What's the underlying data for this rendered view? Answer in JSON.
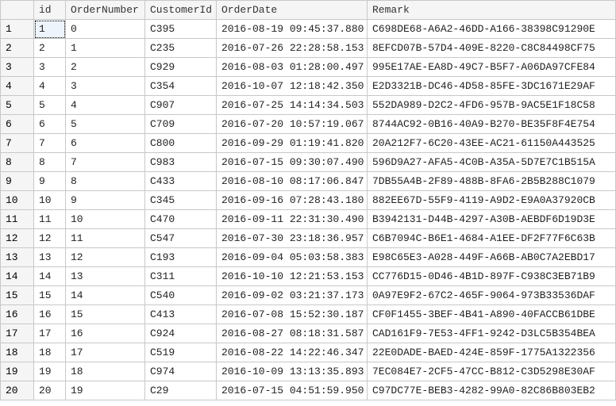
{
  "columns": {
    "id": "id",
    "orderNumber": "OrderNumber",
    "customerId": "CustomerId",
    "orderDate": "OrderDate",
    "remark": "Remark"
  },
  "rows": [
    {
      "n": "1",
      "id": "1",
      "orderNumber": "0",
      "customerId": "C395",
      "orderDate": "2016-08-19 09:45:37.880",
      "remark": "C698DE68-A6A2-46DD-A166-38398C91290E"
    },
    {
      "n": "2",
      "id": "2",
      "orderNumber": "1",
      "customerId": "C235",
      "orderDate": "2016-07-26 22:28:58.153",
      "remark": "8EFCD07B-57D4-409E-8220-C8C84498CF75"
    },
    {
      "n": "3",
      "id": "3",
      "orderNumber": "2",
      "customerId": "C929",
      "orderDate": "2016-08-03 01:28:00.497",
      "remark": "995E17AE-EA8D-49C7-B5F7-A06DA97CFE84"
    },
    {
      "n": "4",
      "id": "4",
      "orderNumber": "3",
      "customerId": "C354",
      "orderDate": "2016-10-07 12:18:42.350",
      "remark": "E2D3321B-DC46-4D58-85FE-3DC1671E29AF"
    },
    {
      "n": "5",
      "id": "5",
      "orderNumber": "4",
      "customerId": "C907",
      "orderDate": "2016-07-25 14:14:34.503",
      "remark": "552DA989-D2C2-4FD6-957B-9AC5E1F18C58"
    },
    {
      "n": "6",
      "id": "6",
      "orderNumber": "5",
      "customerId": "C709",
      "orderDate": "2016-07-20 10:57:19.067",
      "remark": "8744AC92-0B16-40A9-B270-BE35F8F4E754"
    },
    {
      "n": "7",
      "id": "7",
      "orderNumber": "6",
      "customerId": "C800",
      "orderDate": "2016-09-29 01:19:41.820",
      "remark": "20A212F7-6C20-43EE-AC21-61150A443525"
    },
    {
      "n": "8",
      "id": "8",
      "orderNumber": "7",
      "customerId": "C983",
      "orderDate": "2016-07-15 09:30:07.490",
      "remark": "596D9A27-AFA5-4C0B-A35A-5D7E7C1B515A"
    },
    {
      "n": "9",
      "id": "9",
      "orderNumber": "8",
      "customerId": "C433",
      "orderDate": "2016-08-10 08:17:06.847",
      "remark": "7DB55A4B-2F89-488B-8FA6-2B5B288C1079"
    },
    {
      "n": "10",
      "id": "10",
      "orderNumber": "9",
      "customerId": "C345",
      "orderDate": "2016-09-16 07:28:43.180",
      "remark": "882EE67D-55F9-4119-A9D2-E9A0A37920CB"
    },
    {
      "n": "11",
      "id": "11",
      "orderNumber": "10",
      "customerId": "C470",
      "orderDate": "2016-09-11 22:31:30.490",
      "remark": "B3942131-D44B-4297-A30B-AEBDF6D19D3E"
    },
    {
      "n": "12",
      "id": "12",
      "orderNumber": "11",
      "customerId": "C547",
      "orderDate": "2016-07-30 23:18:36.957",
      "remark": "C6B7094C-B6E1-4684-A1EE-DF2F77F6C63B"
    },
    {
      "n": "13",
      "id": "13",
      "orderNumber": "12",
      "customerId": "C193",
      "orderDate": "2016-09-04 05:03:58.383",
      "remark": "E98C65E3-A028-449F-A66B-AB0C7A2EBD17"
    },
    {
      "n": "14",
      "id": "14",
      "orderNumber": "13",
      "customerId": "C311",
      "orderDate": "2016-10-10 12:21:53.153",
      "remark": "CC776D15-0D46-4B1D-897F-C938C3EB71B9"
    },
    {
      "n": "15",
      "id": "15",
      "orderNumber": "14",
      "customerId": "C540",
      "orderDate": "2016-09-02 03:21:37.173",
      "remark": "0A97E9F2-67C2-465F-9064-973B33536DAF"
    },
    {
      "n": "16",
      "id": "16",
      "orderNumber": "15",
      "customerId": "C413",
      "orderDate": "2016-07-08 15:52:30.187",
      "remark": "CF0F1455-3BEF-4B41-A890-40FACCB61DBE"
    },
    {
      "n": "17",
      "id": "17",
      "orderNumber": "16",
      "customerId": "C924",
      "orderDate": "2016-08-27 08:18:31.587",
      "remark": "CAD161F9-7E53-4FF1-9242-D3LC5B354BEA"
    },
    {
      "n": "18",
      "id": "18",
      "orderNumber": "17",
      "customerId": "C519",
      "orderDate": "2016-08-22 14:22:46.347",
      "remark": "22E0DADE-BAED-424E-859F-1775A1322356"
    },
    {
      "n": "19",
      "id": "19",
      "orderNumber": "18",
      "customerId": "C974",
      "orderDate": "2016-10-09 13:13:35.893",
      "remark": "7EC084E7-2CF5-47CC-B812-C3D5298E30AF"
    },
    {
      "n": "20",
      "id": "20",
      "orderNumber": "19",
      "customerId": "C29",
      "orderDate": "2016-07-15 04:51:59.950",
      "remark": "C97DC77E-BEB3-4282-99A0-82C86B803EB2"
    }
  ],
  "selection": {
    "row": 0,
    "col": "id"
  }
}
